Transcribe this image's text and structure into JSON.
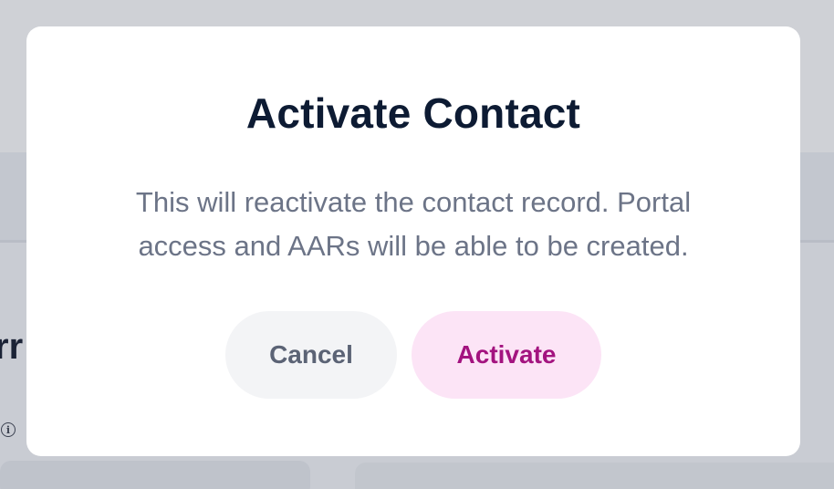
{
  "background": {
    "heading_fragment": "rr",
    "info_icon": "info-icon"
  },
  "modal": {
    "title": "Activate Contact",
    "message": "This will reactivate the contact record. Portal access and AARs will be able to be created.",
    "cancel_label": "Cancel",
    "confirm_label": "Activate"
  },
  "colors": {
    "title": "#0d1b33",
    "message": "#6c7487",
    "cancel_bg": "#f3f4f6",
    "cancel_text": "#5b6375",
    "confirm_bg": "#fce4f6",
    "confirm_text": "#a3137f",
    "overlay": "#c9ccd3"
  }
}
